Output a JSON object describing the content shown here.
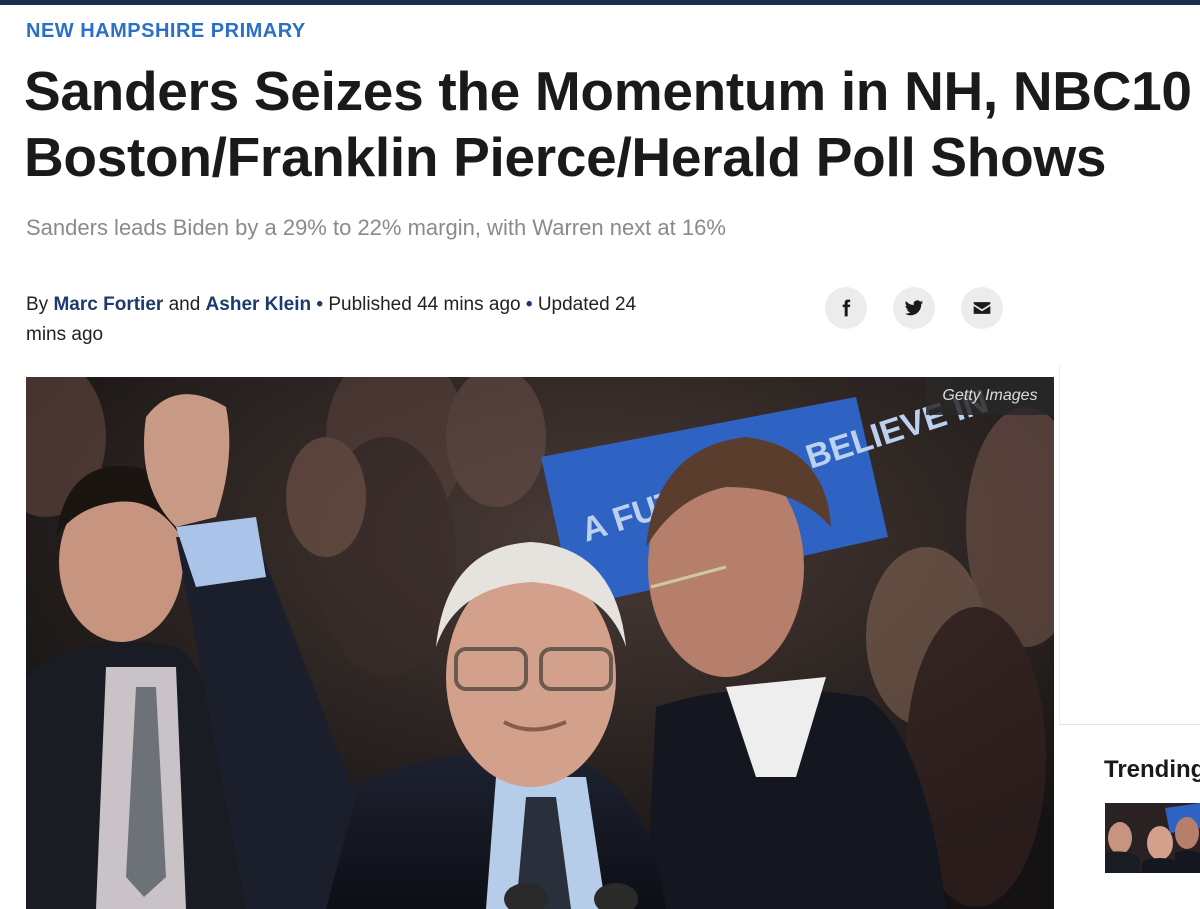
{
  "article": {
    "kicker": "NEW HAMPSHIRE PRIMARY",
    "headline": "Sanders Seizes the Momentum in NH, NBC10 Boston/Franklin Pierce/Herald Poll Shows",
    "subheadline": "Sanders leads Biden by a 29% to 22% margin, with Warren next at 16%",
    "byline": {
      "prefix": "By",
      "author1": "Marc Fortier",
      "conjunction": "and",
      "author2": "Asher Klein",
      "separator": "•",
      "published": "Published 44 mins ago",
      "updated": "Updated 24 mins ago"
    },
    "share": [
      {
        "icon": "facebook-icon"
      },
      {
        "icon": "twitter-icon"
      },
      {
        "icon": "email-icon"
      }
    ],
    "hero_image": {
      "credit": "Getty Images",
      "sign_text": "A FUTURE TO BELIEVE IN"
    }
  },
  "sidebar": {
    "trending_title": "Trending"
  },
  "colors": {
    "kicker": "#2a6fc9",
    "author_link": "#1d3a6e",
    "top_bar": "#1d2d4f",
    "subhead": "#8a8a8a"
  }
}
